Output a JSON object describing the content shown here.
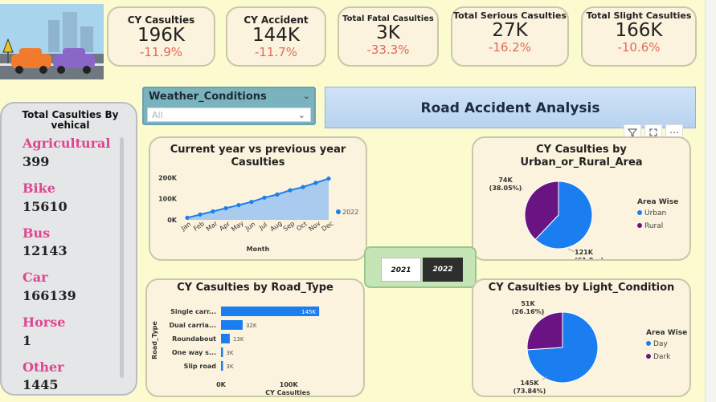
{
  "kpis": [
    {
      "label": "CY Casulties",
      "value": "196K",
      "change": "-11.9%"
    },
    {
      "label": "CY Accident",
      "value": "144K",
      "change": "-11.7%"
    },
    {
      "label": "Total Fatal Casulties",
      "value": "3K",
      "change": "-33.3%"
    },
    {
      "label": "Total Serious Casulties",
      "value": "27K",
      "change": "-16.2%"
    },
    {
      "label": "Total Slight Casulties",
      "value": "166K",
      "change": "-10.6%"
    }
  ],
  "slicer": {
    "title": "Weather_Conditions",
    "value": "All"
  },
  "report_title": "Road Accident Analysis",
  "vehicle_panel": {
    "title": "Total Casulties By vehical",
    "items": [
      {
        "name": "Agricultural",
        "value": "399"
      },
      {
        "name": "Bike",
        "value": "15610"
      },
      {
        "name": "Bus",
        "value": "12143"
      },
      {
        "name": "Car",
        "value": "166139"
      },
      {
        "name": "Horse",
        "value": "1"
      },
      {
        "name": "Other",
        "value": "1445"
      }
    ]
  },
  "year_selector": {
    "options": [
      "2021",
      "2022"
    ],
    "selected": "2022"
  },
  "colors": {
    "accent_blue": "#1b7ef0",
    "purple": "#6a1483",
    "area": "#9fc7ef",
    "kpi_change": "#e06a5a"
  },
  "icons": [
    "filter-icon",
    "focus-mode-icon",
    "more-options-icon",
    "chevron-down-icon"
  ],
  "chart_data": [
    {
      "type": "area",
      "title": "Current year vs previous year Casulties",
      "xlabel": "Month",
      "ylabel": "",
      "categories": [
        "Jan",
        "Feb",
        "Mar",
        "Apr",
        "May",
        "Jun",
        "Jul",
        "Aug",
        "Sep",
        "Oct",
        "Nov",
        "Dec"
      ],
      "yticks": [
        "0K",
        "100K",
        "200K"
      ],
      "ylim": [
        0,
        220
      ],
      "series": [
        {
          "name": "2022",
          "values": [
            10,
            25,
            40,
            55,
            70,
            85,
            105,
            120,
            140,
            155,
            175,
            195
          ]
        }
      ]
    },
    {
      "type": "pie",
      "title": "CY Casulties by Urban_or_Rural_Area",
      "legend_title": "Area Wise",
      "slices": [
        {
          "name": "Urban",
          "value": 121,
          "label": "121K (61.9...)",
          "color": "#1b7ef0"
        },
        {
          "name": "Rural",
          "value": 74,
          "label": "74K (38.05%)",
          "color": "#6a1483"
        }
      ]
    },
    {
      "type": "bar",
      "orientation": "horizontal",
      "title": "CY Casulties by Road_Type",
      "xlabel": "CY Casulties",
      "ylabel": "Road_Type",
      "xticks": [
        "0K",
        "100K"
      ],
      "xlim": [
        0,
        190
      ],
      "categories": [
        "Single carr...",
        "Dual carria...",
        "Roundabout",
        "One way s...",
        "Slip road"
      ],
      "values": [
        145,
        32,
        13,
        3,
        3
      ],
      "labels": [
        "145K",
        "32K",
        "13K",
        "3K",
        "3K"
      ]
    },
    {
      "type": "pie",
      "title": "CY Casulties by Light_Condition",
      "legend_title": "Area Wise",
      "slices": [
        {
          "name": "Day",
          "value": 145,
          "label": "145K (73.84%)",
          "color": "#1b7ef0"
        },
        {
          "name": "Dark",
          "value": 51,
          "label": "51K (26.16%)",
          "color": "#6a1483"
        }
      ]
    }
  ]
}
